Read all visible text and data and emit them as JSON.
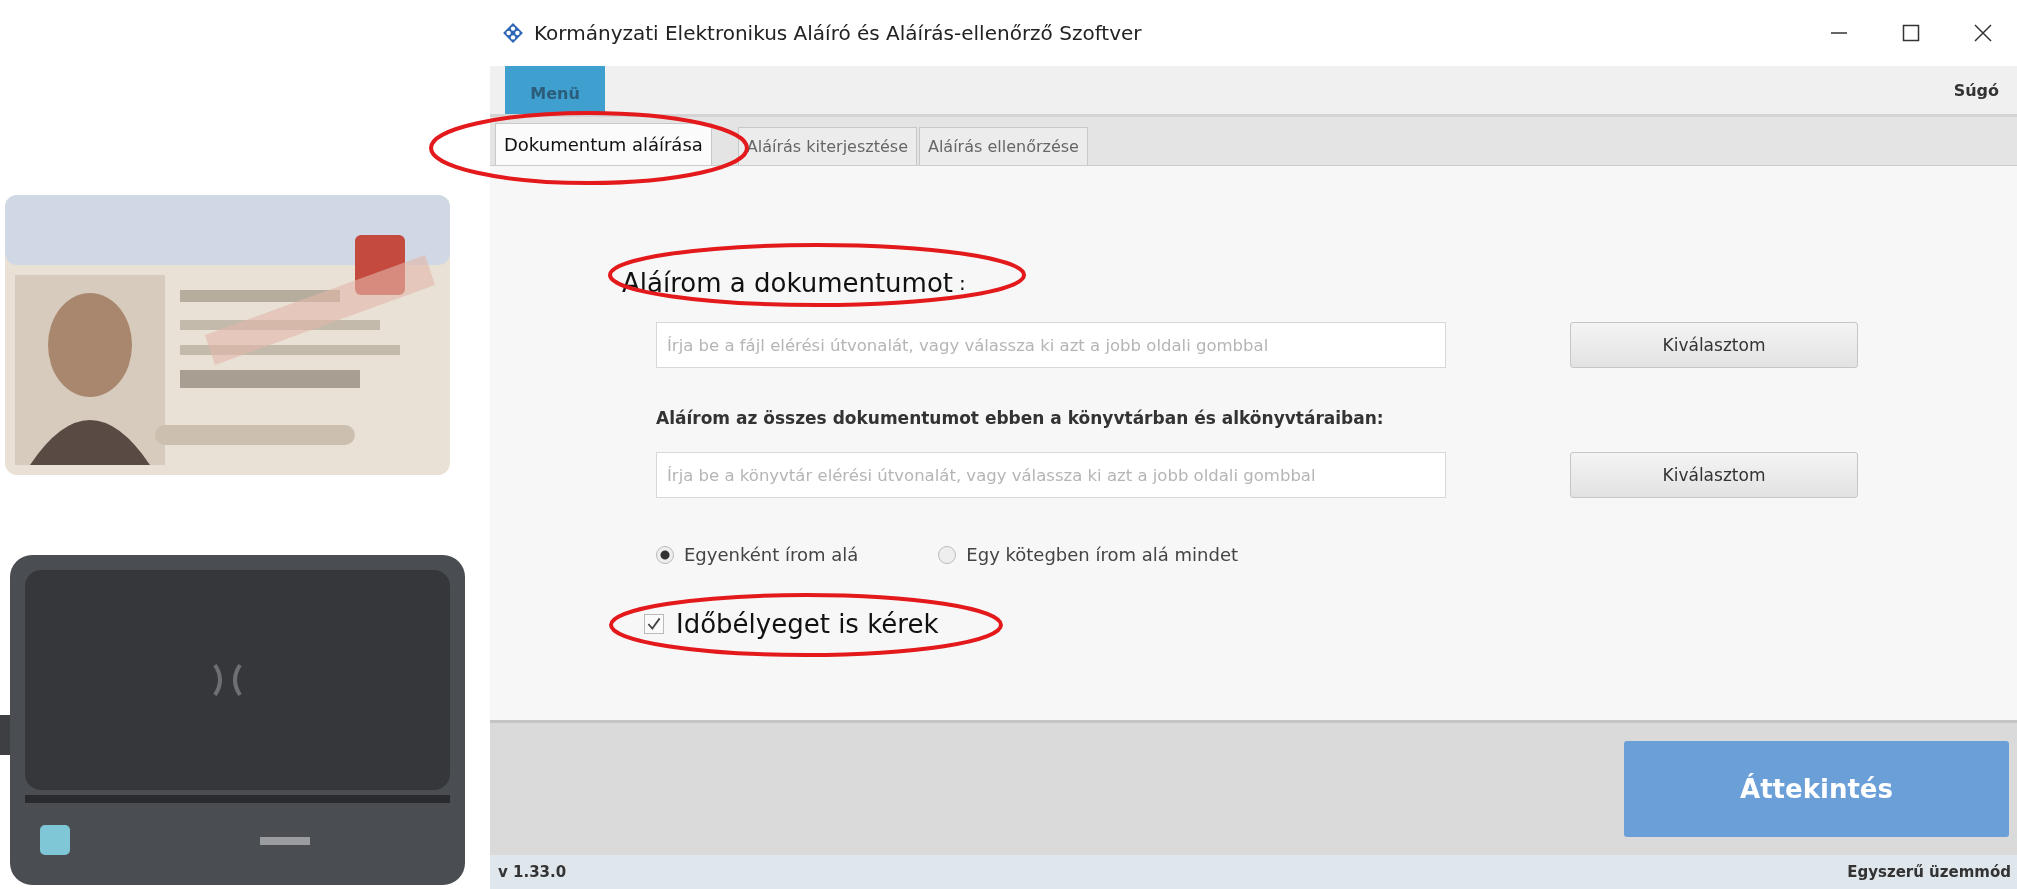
{
  "window": {
    "title": "Kormányzati Elektronikus Aláíró és Aláírás-ellenőrző Szoftver"
  },
  "menu_bar": {
    "menu": "Menü",
    "help": "Súgó"
  },
  "tabs": [
    {
      "label": "Dokumentum aláírása",
      "selected": true
    },
    {
      "label": "Aláírás kiterjesztése",
      "selected": false
    },
    {
      "label": "Aláírás ellenőrzése",
      "selected": false
    }
  ],
  "sign_document": {
    "heading": "Aláírom a dokumentumot",
    "heading_colon": ":",
    "field": {
      "placeholder": "Írja be a fájl elérési útvonalát, vagy válassza ki azt a jobb oldali gombbal"
    },
    "button": "Kiválasztom"
  },
  "sign_folder": {
    "label": "Aláírom az összes dokumentumot ebben a könyvtárban és alkönyvtáraiban:",
    "field": {
      "placeholder": "Írja be a könyvtár elérési útvonalát, vagy válassza ki azt a jobb oldali gombbal"
    },
    "button": "Kiválasztom"
  },
  "sign_mode": [
    {
      "label": "Egyenként írom alá",
      "selected": true
    },
    {
      "label": "Egy kötegben írom alá mindet",
      "selected": false
    }
  ],
  "timestamp": {
    "label": "Időbélyeget is kérek",
    "checked": true
  },
  "primary_button": "Áttekintés",
  "status_bar": {
    "version": "v 1.33.0",
    "mode": "Egyszerű üzemmód"
  }
}
